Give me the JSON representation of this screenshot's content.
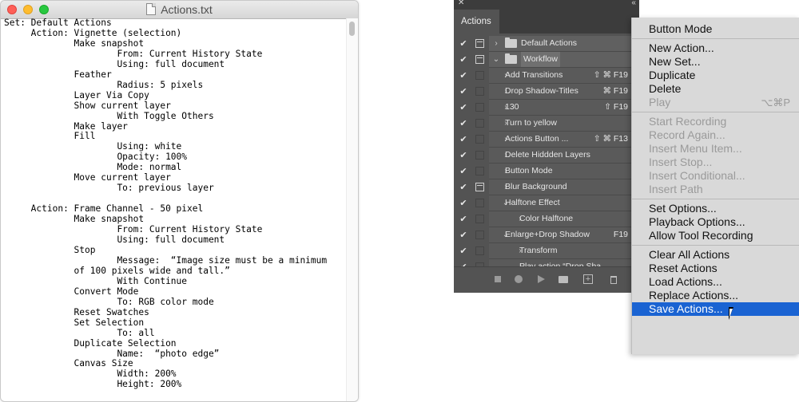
{
  "textedit": {
    "title": "Actions.txt",
    "lines": [
      "Set: Default Actions",
      "     Action: Vignette (selection)",
      "             Make snapshot",
      "                     From: Current History State",
      "                     Using: full document",
      "             Feather",
      "                     Radius: 5 pixels",
      "             Layer Via Copy",
      "             Show current layer",
      "                     With Toggle Others",
      "             Make layer",
      "             Fill",
      "                     Using: white",
      "                     Opacity: 100%",
      "                     Mode: normal",
      "             Move current layer",
      "                     To: previous layer",
      "",
      "     Action: Frame Channel - 50 pixel",
      "             Make snapshot",
      "                     From: Current History State",
      "                     Using: full document",
      "             Stop",
      "                     Message:  “Image size must be a minimum",
      "             of 100 pixels wide and tall.”",
      "                     With Continue",
      "             Convert Mode",
      "                     To: RGB color mode",
      "             Reset Swatches",
      "             Set Selection",
      "                     To: all",
      "             Duplicate Selection",
      "                     Name:  “photo edge”",
      "             Canvas Size",
      "                     Width: 200%",
      "                     Height: 200%"
    ]
  },
  "panel": {
    "close_glyph": "✕",
    "collapse_glyph": "‹‹",
    "tab_label": "Actions",
    "menu_glyph": "≡",
    "rows": [
      {
        "label": "Default Actions",
        "key": "",
        "check": true,
        "dialog": true,
        "caret": "›",
        "indent": 0,
        "folder": true
      },
      {
        "label": "Workflow",
        "key": "",
        "check": true,
        "dialog": true,
        "caret": "⌄",
        "indent": 0,
        "folder": true,
        "highlight": true
      },
      {
        "label": "Add Transitions",
        "key": "⇧ ⌘ F19",
        "check": true,
        "dialog": false,
        "caret": "›",
        "indent": 1
      },
      {
        "label": "Drop Shadow-Titles",
        "key": "⌘ F19",
        "check": true,
        "dialog": false,
        "caret": "›",
        "indent": 1
      },
      {
        "label": "130",
        "key": "⇧ F19",
        "check": true,
        "dialog": false,
        "caret": "›",
        "indent": 1
      },
      {
        "label": "Turn to yellow",
        "key": "",
        "check": true,
        "dialog": false,
        "caret": "›",
        "indent": 1
      },
      {
        "label": "Actions Button ...",
        "key": "⇧ ⌘ F13",
        "check": true,
        "dialog": false,
        "caret": "›",
        "indent": 1
      },
      {
        "label": "Delete Hiddden Layers",
        "key": "",
        "check": true,
        "dialog": false,
        "caret": "›",
        "indent": 1
      },
      {
        "label": "Button Mode",
        "key": "",
        "check": true,
        "dialog": false,
        "caret": "›",
        "indent": 1
      },
      {
        "label": "Blur Background",
        "key": "",
        "check": true,
        "dialog": true,
        "caret": "›",
        "indent": 1
      },
      {
        "label": "Halftone Effect",
        "key": "",
        "check": true,
        "dialog": false,
        "caret": "⌄",
        "indent": 1
      },
      {
        "label": "Color Halftone",
        "key": "",
        "check": true,
        "dialog": false,
        "caret": "›",
        "indent": 2
      },
      {
        "label": "Enlarge+Drop Shadow",
        "key": "F19",
        "check": true,
        "dialog": false,
        "caret": "⌄",
        "indent": 1
      },
      {
        "label": "Transform",
        "key": "",
        "check": true,
        "dialog": false,
        "caret": "›",
        "indent": 2
      },
      {
        "label": "Play action “Drop Sha...",
        "key": "",
        "check": true,
        "dialog": false,
        "caret": "",
        "indent": 2
      }
    ],
    "bottom_icons": [
      "stop-icon",
      "record-icon",
      "play-icon",
      "new-set-icon",
      "new-action-icon",
      "trash-icon"
    ],
    "new_action_glyph": "+"
  },
  "menu": {
    "groups": [
      [
        {
          "label": "Button Mode",
          "enabled": true
        }
      ],
      [
        {
          "label": "New Action...",
          "enabled": true
        },
        {
          "label": "New Set...",
          "enabled": true
        },
        {
          "label": "Duplicate",
          "enabled": true
        },
        {
          "label": "Delete",
          "enabled": true
        },
        {
          "label": "Play",
          "enabled": false,
          "shortcut": "⌥⌘P"
        }
      ],
      [
        {
          "label": "Start Recording",
          "enabled": false
        },
        {
          "label": "Record Again...",
          "enabled": false
        },
        {
          "label": "Insert Menu Item...",
          "enabled": false
        },
        {
          "label": "Insert Stop...",
          "enabled": false
        },
        {
          "label": "Insert Conditional...",
          "enabled": false
        },
        {
          "label": "Insert Path",
          "enabled": false
        }
      ],
      [
        {
          "label": "Set Options...",
          "enabled": true
        },
        {
          "label": "Playback Options...",
          "enabled": true
        },
        {
          "label": "Allow Tool Recording",
          "enabled": true
        }
      ],
      [
        {
          "label": "Clear All Actions",
          "enabled": true
        },
        {
          "label": "Reset Actions",
          "enabled": true
        },
        {
          "label": "Load Actions...",
          "enabled": true
        },
        {
          "label": "Replace Actions...",
          "enabled": true
        },
        {
          "label": "Save Actions...",
          "enabled": true,
          "highlighted": true
        }
      ]
    ]
  },
  "colors": {
    "menu_highlight": "#1a63d2",
    "panel_bg": "#535353",
    "close_light": "#fe5f57",
    "minimize_light": "#febc2e",
    "zoom_light": "#28c840"
  }
}
